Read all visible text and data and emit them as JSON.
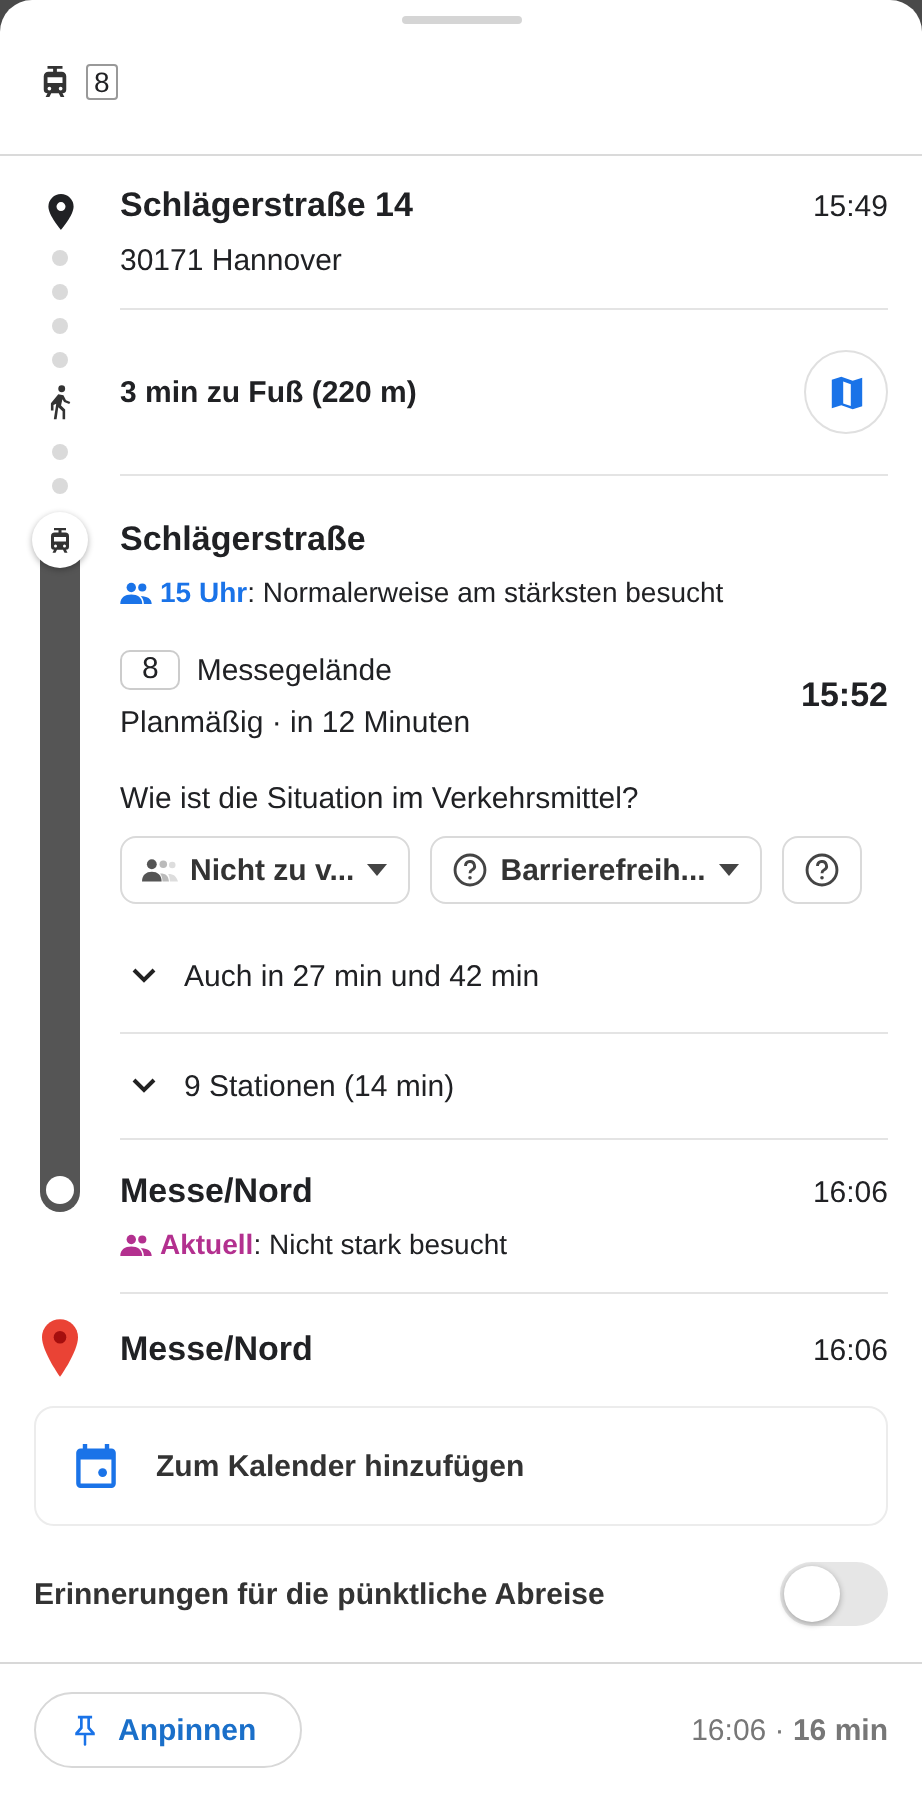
{
  "header": {
    "line": "8"
  },
  "origin": {
    "name": "Schlägerstraße 14",
    "address": "30171 Hannover",
    "time": "15:49"
  },
  "walk": {
    "text": "3 min zu Fuß (220 m)"
  },
  "transit": {
    "stop": "Schlägerstraße",
    "crowd": {
      "highlight": "15 Uhr",
      "text": ": Normalerweise am stärksten besucht",
      "color": "#1a73e8"
    },
    "line": "8",
    "headsign": "Messegelände",
    "status": "Planmäßig · in 12 Minuten",
    "departure": "15:52",
    "question": "Wie ist die Situation im Verkehrsmittel?",
    "chips": [
      {
        "kind": "crowd",
        "label": "Nicht zu v..."
      },
      {
        "kind": "help",
        "label": "Barrierefreih..."
      },
      {
        "kind": "help"
      }
    ],
    "more_departures": {
      "text": "Auch in 27 min und 42 min",
      "expanded": false
    },
    "stops_summary": {
      "text": "9 Stationen (14 min)",
      "expanded": false
    },
    "arrival": {
      "name": "Messe/Nord",
      "time": "16:06",
      "crowd": {
        "highlight": "Aktuell",
        "text": ": Nicht stark besucht",
        "color": "#b3308f"
      }
    }
  },
  "destination": {
    "name": "Messe/Nord",
    "time": "16:06"
  },
  "calendar_button": "Zum Kalender hinzufügen",
  "reminder": {
    "label": "Erinnerungen für die pünktliche Abreise",
    "on": false
  },
  "footer": {
    "pin_button": "Anpinnen",
    "summary": "16:06 · **16 min**"
  }
}
